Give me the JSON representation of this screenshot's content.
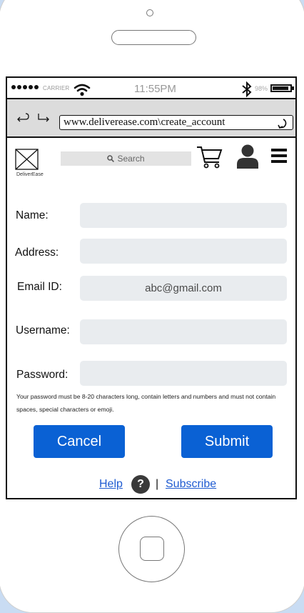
{
  "status": {
    "carrier": "CARRIER",
    "time": "11:55PM",
    "battery_percent": "98%",
    "battery_level": 0.9
  },
  "browser": {
    "url": "www.deliverease.com\\create_account",
    "icons": [
      "back-arrow-icon",
      "forward-arrow-icon",
      "reload-icon"
    ]
  },
  "nav": {
    "logo_text": "DeliverEase",
    "search_placeholder": "Search",
    "icons": [
      "envelope-icon",
      "search-icon",
      "cart-icon",
      "user-icon",
      "menu-icon"
    ]
  },
  "form": {
    "name_label": "Name:",
    "name_value": "",
    "address_label": "Address:",
    "address_value": "",
    "email_label": "Email ID:",
    "email_value": "abc@gmail.com",
    "username_label": "Username:",
    "username_value": "",
    "password_label": "Password:",
    "password_value": "",
    "password_hint": "Your password must be 8-20 characters long, contain letters and numbers and must not contain spaces, special characters or emoji."
  },
  "actions": {
    "cancel_label": "Cancel",
    "submit_label": "Submit"
  },
  "footer": {
    "help_label": "Help",
    "help_icon_glyph": "?",
    "separator": "|",
    "subscribe_label": "Subscribe"
  },
  "colors": {
    "button": "#0a61d4",
    "link": "#1f5bd1",
    "background": "#c9dcf3"
  }
}
